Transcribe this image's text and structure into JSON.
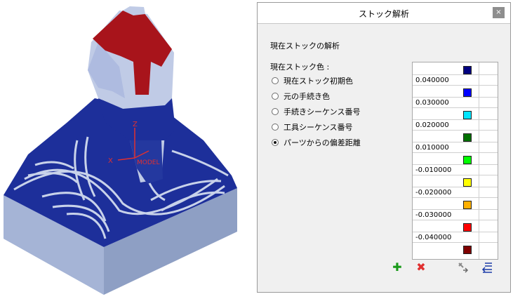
{
  "model": {
    "axis_x": "X",
    "axis_z": "Z",
    "axis_label": "MODEL"
  },
  "dialog": {
    "title": "ストック解析",
    "close_symbol": "×",
    "heading": "現在ストックの解析",
    "color_label": "現在ストック色 :",
    "options": [
      {
        "label": "現在ストック初期色",
        "selected": false
      },
      {
        "label": "元の手続き色",
        "selected": false
      },
      {
        "label": "手続きシーケンス番号",
        "selected": false
      },
      {
        "label": "工具シーケンス番号",
        "selected": false
      },
      {
        "label": "パーツからの偏差距離",
        "selected": true
      }
    ],
    "legend": {
      "values": [
        "0.040000",
        "0.030000",
        "0.020000",
        "0.010000",
        "-0.010000",
        "-0.020000",
        "-0.030000",
        "-0.040000"
      ],
      "colors": [
        "#000080",
        "#0000ff",
        "#00e5ff",
        "#007000",
        "#00ff00",
        "#ffff00",
        "#ffb000",
        "#ff0000",
        "#800000"
      ]
    },
    "toolbar": {
      "add_symbol": "✚",
      "delete_symbol": "✖",
      "tool_icon": "wrench-arrow-icon",
      "list_icon": "list-arrow-icon",
      "add_color": "#1a9a1a",
      "delete_color": "#e03030"
    }
  }
}
